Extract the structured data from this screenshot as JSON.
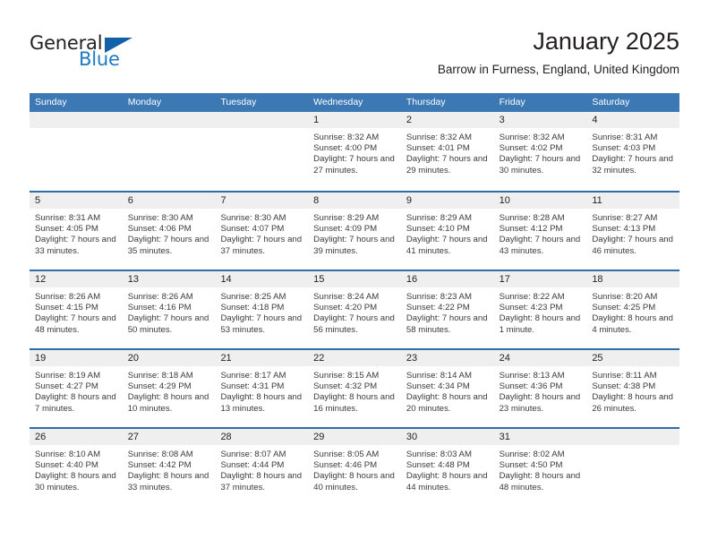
{
  "brand": {
    "name_part1": "General",
    "name_part2": "Blue"
  },
  "header": {
    "title": "January 2025",
    "subtitle": "Barrow in Furness, England, United Kingdom"
  },
  "weekdays": [
    "Sunday",
    "Monday",
    "Tuesday",
    "Wednesday",
    "Thursday",
    "Friday",
    "Saturday"
  ],
  "colors": {
    "header_blue": "#3b78b4",
    "row_divider_blue": "#2f6cab",
    "day_band_gray": "#efefef",
    "brand_blue": "#1f7ac4",
    "text": "#231f20"
  },
  "weeks": [
    [
      {
        "day": "",
        "empty": true
      },
      {
        "day": "",
        "empty": true
      },
      {
        "day": "",
        "empty": true
      },
      {
        "day": "1",
        "sunrise": "Sunrise: 8:32 AM",
        "sunset": "Sunset: 4:00 PM",
        "daylight": "Daylight: 7 hours and 27 minutes."
      },
      {
        "day": "2",
        "sunrise": "Sunrise: 8:32 AM",
        "sunset": "Sunset: 4:01 PM",
        "daylight": "Daylight: 7 hours and 29 minutes."
      },
      {
        "day": "3",
        "sunrise": "Sunrise: 8:32 AM",
        "sunset": "Sunset: 4:02 PM",
        "daylight": "Daylight: 7 hours and 30 minutes."
      },
      {
        "day": "4",
        "sunrise": "Sunrise: 8:31 AM",
        "sunset": "Sunset: 4:03 PM",
        "daylight": "Daylight: 7 hours and 32 minutes."
      }
    ],
    [
      {
        "day": "5",
        "sunrise": "Sunrise: 8:31 AM",
        "sunset": "Sunset: 4:05 PM",
        "daylight": "Daylight: 7 hours and 33 minutes."
      },
      {
        "day": "6",
        "sunrise": "Sunrise: 8:30 AM",
        "sunset": "Sunset: 4:06 PM",
        "daylight": "Daylight: 7 hours and 35 minutes."
      },
      {
        "day": "7",
        "sunrise": "Sunrise: 8:30 AM",
        "sunset": "Sunset: 4:07 PM",
        "daylight": "Daylight: 7 hours and 37 minutes."
      },
      {
        "day": "8",
        "sunrise": "Sunrise: 8:29 AM",
        "sunset": "Sunset: 4:09 PM",
        "daylight": "Daylight: 7 hours and 39 minutes."
      },
      {
        "day": "9",
        "sunrise": "Sunrise: 8:29 AM",
        "sunset": "Sunset: 4:10 PM",
        "daylight": "Daylight: 7 hours and 41 minutes."
      },
      {
        "day": "10",
        "sunrise": "Sunrise: 8:28 AM",
        "sunset": "Sunset: 4:12 PM",
        "daylight": "Daylight: 7 hours and 43 minutes."
      },
      {
        "day": "11",
        "sunrise": "Sunrise: 8:27 AM",
        "sunset": "Sunset: 4:13 PM",
        "daylight": "Daylight: 7 hours and 46 minutes."
      }
    ],
    [
      {
        "day": "12",
        "sunrise": "Sunrise: 8:26 AM",
        "sunset": "Sunset: 4:15 PM",
        "daylight": "Daylight: 7 hours and 48 minutes."
      },
      {
        "day": "13",
        "sunrise": "Sunrise: 8:26 AM",
        "sunset": "Sunset: 4:16 PM",
        "daylight": "Daylight: 7 hours and 50 minutes."
      },
      {
        "day": "14",
        "sunrise": "Sunrise: 8:25 AM",
        "sunset": "Sunset: 4:18 PM",
        "daylight": "Daylight: 7 hours and 53 minutes."
      },
      {
        "day": "15",
        "sunrise": "Sunrise: 8:24 AM",
        "sunset": "Sunset: 4:20 PM",
        "daylight": "Daylight: 7 hours and 56 minutes."
      },
      {
        "day": "16",
        "sunrise": "Sunrise: 8:23 AM",
        "sunset": "Sunset: 4:22 PM",
        "daylight": "Daylight: 7 hours and 58 minutes."
      },
      {
        "day": "17",
        "sunrise": "Sunrise: 8:22 AM",
        "sunset": "Sunset: 4:23 PM",
        "daylight": "Daylight: 8 hours and 1 minute."
      },
      {
        "day": "18",
        "sunrise": "Sunrise: 8:20 AM",
        "sunset": "Sunset: 4:25 PM",
        "daylight": "Daylight: 8 hours and 4 minutes."
      }
    ],
    [
      {
        "day": "19",
        "sunrise": "Sunrise: 8:19 AM",
        "sunset": "Sunset: 4:27 PM",
        "daylight": "Daylight: 8 hours and 7 minutes."
      },
      {
        "day": "20",
        "sunrise": "Sunrise: 8:18 AM",
        "sunset": "Sunset: 4:29 PM",
        "daylight": "Daylight: 8 hours and 10 minutes."
      },
      {
        "day": "21",
        "sunrise": "Sunrise: 8:17 AM",
        "sunset": "Sunset: 4:31 PM",
        "daylight": "Daylight: 8 hours and 13 minutes."
      },
      {
        "day": "22",
        "sunrise": "Sunrise: 8:15 AM",
        "sunset": "Sunset: 4:32 PM",
        "daylight": "Daylight: 8 hours and 16 minutes."
      },
      {
        "day": "23",
        "sunrise": "Sunrise: 8:14 AM",
        "sunset": "Sunset: 4:34 PM",
        "daylight": "Daylight: 8 hours and 20 minutes."
      },
      {
        "day": "24",
        "sunrise": "Sunrise: 8:13 AM",
        "sunset": "Sunset: 4:36 PM",
        "daylight": "Daylight: 8 hours and 23 minutes."
      },
      {
        "day": "25",
        "sunrise": "Sunrise: 8:11 AM",
        "sunset": "Sunset: 4:38 PM",
        "daylight": "Daylight: 8 hours and 26 minutes."
      }
    ],
    [
      {
        "day": "26",
        "sunrise": "Sunrise: 8:10 AM",
        "sunset": "Sunset: 4:40 PM",
        "daylight": "Daylight: 8 hours and 30 minutes."
      },
      {
        "day": "27",
        "sunrise": "Sunrise: 8:08 AM",
        "sunset": "Sunset: 4:42 PM",
        "daylight": "Daylight: 8 hours and 33 minutes."
      },
      {
        "day": "28",
        "sunrise": "Sunrise: 8:07 AM",
        "sunset": "Sunset: 4:44 PM",
        "daylight": "Daylight: 8 hours and 37 minutes."
      },
      {
        "day": "29",
        "sunrise": "Sunrise: 8:05 AM",
        "sunset": "Sunset: 4:46 PM",
        "daylight": "Daylight: 8 hours and 40 minutes."
      },
      {
        "day": "30",
        "sunrise": "Sunrise: 8:03 AM",
        "sunset": "Sunset: 4:48 PM",
        "daylight": "Daylight: 8 hours and 44 minutes."
      },
      {
        "day": "31",
        "sunrise": "Sunrise: 8:02 AM",
        "sunset": "Sunset: 4:50 PM",
        "daylight": "Daylight: 8 hours and 48 minutes."
      },
      {
        "day": "",
        "empty": true
      }
    ]
  ]
}
